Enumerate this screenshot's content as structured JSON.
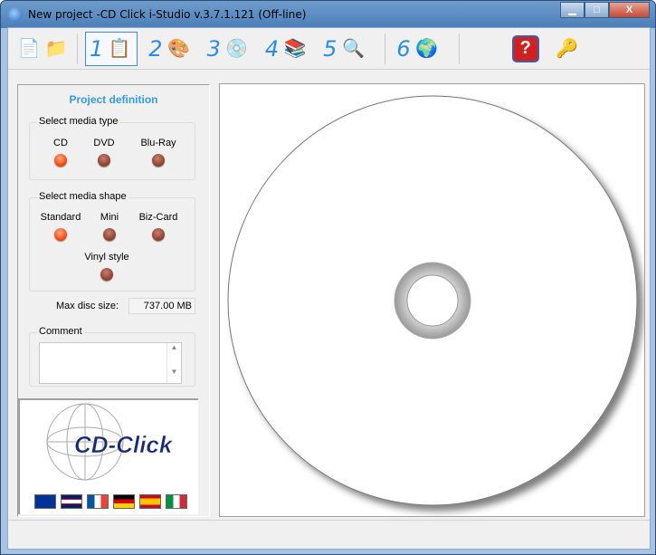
{
  "window": {
    "title": "New project -CD Click i-Studio v.3.7.1.121 (Off-line)",
    "minimize": "▁",
    "maximize": "□",
    "close": "X"
  },
  "toolbar": {
    "steps": [
      {
        "num": "1",
        "icon": "clipboard-edit-icon"
      },
      {
        "num": "2",
        "icon": "paint-bucket-icon"
      },
      {
        "num": "3",
        "icon": "disc-icon"
      },
      {
        "num": "4",
        "icon": "disc-stack-icon"
      },
      {
        "num": "5",
        "icon": "print-preview-icon"
      },
      {
        "num": "6",
        "icon": "globe-icon"
      }
    ],
    "selected_step": "1"
  },
  "panel": {
    "title": "Project definition",
    "media_type": {
      "label": "Select media type",
      "options": [
        "CD",
        "DVD",
        "Blu-Ray"
      ],
      "selected": "CD"
    },
    "media_shape": {
      "label": "Select media shape",
      "options": [
        "Standard",
        "Mini",
        "Biz-Card",
        "Vinyl style"
      ],
      "selected": "Standard"
    },
    "max_size_label": "Max disc size:",
    "max_size_value": "737.00 MB",
    "comment_label": "Comment",
    "comment_value": ""
  },
  "logo": {
    "text": "CD-Click"
  },
  "languages": [
    "EU",
    "UK",
    "France",
    "Germany",
    "Spain",
    "Italy"
  ],
  "colors": {
    "accent": "#3399ee",
    "title_bar": "#4b7fb9"
  }
}
